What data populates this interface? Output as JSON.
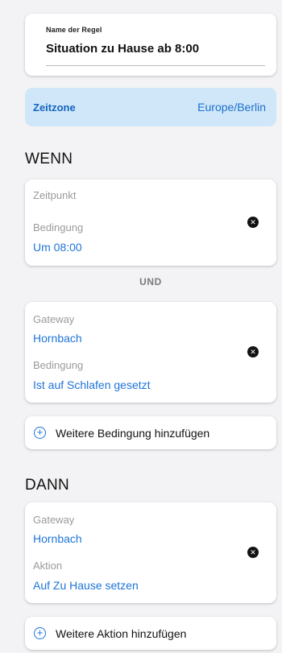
{
  "rule": {
    "name_label": "Name der Regel",
    "name_value": "Situation zu Hause ab 8:00"
  },
  "timezone": {
    "label": "Zeitzone",
    "value": "Europe/Berlin"
  },
  "wenn": {
    "title": "WENN",
    "trigger_card": {
      "label_1": "Zeitpunkt",
      "label_2": "Bedingung",
      "value_2": "Um 08:00",
      "close_icon": "close-circle-icon"
    },
    "connector": "UND",
    "condition_card": {
      "label_1": "Gateway",
      "value_1": "Hornbach",
      "label_2": "Bedingung",
      "value_2": "Ist auf Schlafen gesetzt",
      "close_icon": "close-circle-icon"
    },
    "add_label": "Weitere Bedingung hinzufügen"
  },
  "dann": {
    "title": "DANN",
    "action_card": {
      "label_1": "Gateway",
      "value_1": "Hornbach",
      "label_2": "Aktion",
      "value_2": "Auf Zu Hause setzen",
      "close_icon": "close-circle-icon"
    },
    "add_label": "Weitere Aktion hinzufügen"
  },
  "colors": {
    "accent": "#1e74d8",
    "timezone_bg": "#cfe7f9",
    "background": "#f3f3f5"
  }
}
